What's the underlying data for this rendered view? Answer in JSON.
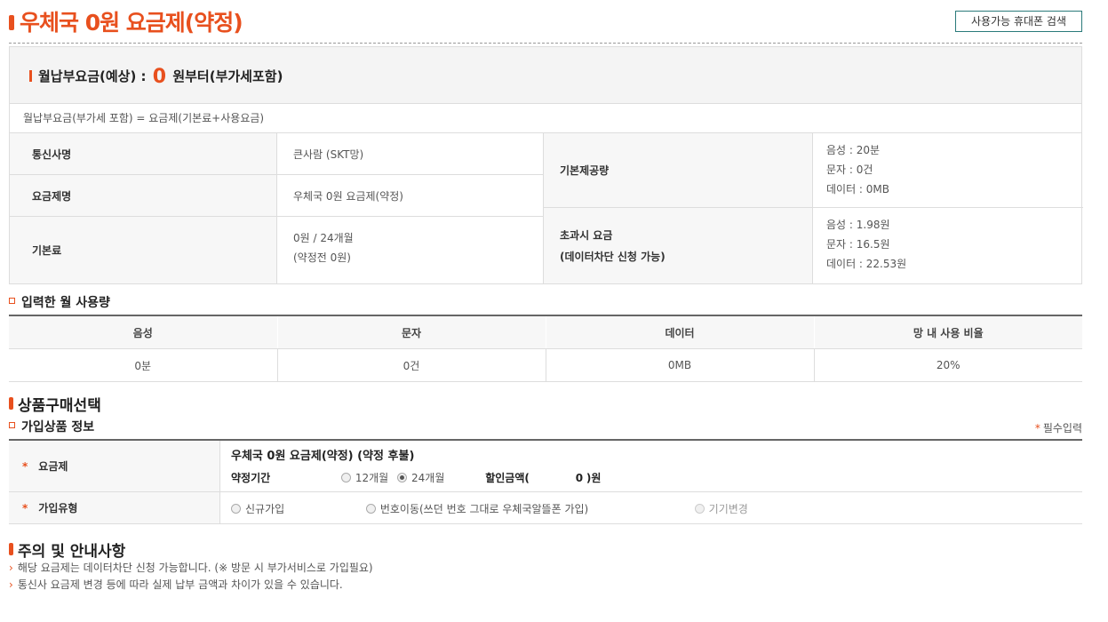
{
  "header": {
    "title": "우체국 0원 요금제(약정)",
    "search_button": "사용가능 휴대폰 검색"
  },
  "summary": {
    "monthly_label": "월납부요금(예상) :",
    "monthly_value": "0",
    "monthly_suffix": "원부터(부가세포함)",
    "formula": "월납부요금(부가세 포함) = 요금제(기본료+사용요금)",
    "carrier_label": "통신사명",
    "carrier_value": "큰사람 (SKT망)",
    "plan_label": "요금제명",
    "plan_value": "우체국 0원 요금제(약정)",
    "base_label": "기본료",
    "base_value_1": "0원 / 24개월",
    "base_value_2": "(약정전 0원)",
    "provided_label": "기본제공량",
    "provided_voice": "음성 : 20분",
    "provided_sms": "문자 : 0건",
    "provided_data": "데이터 : 0MB",
    "overage_label_1": "초과시 요금",
    "overage_label_2": "(데이터차단 신청 가능)",
    "overage_voice": "음성 : 1.98원",
    "overage_sms": "문자 : 16.5원",
    "overage_data": "데이터 : 22.53원"
  },
  "usage": {
    "heading": "입력한 월 사용량",
    "headers": [
      "음성",
      "문자",
      "데이터",
      "망 내 사용 비율"
    ],
    "values": [
      "0분",
      "0건",
      "0MB",
      "20%"
    ]
  },
  "purchase": {
    "heading": "상품구매선택",
    "sub_heading": "가입상품 정보",
    "required_note": "필수입력",
    "required_star": "*",
    "plan_label": "요금제",
    "plan_name": "우체국 0원 요금제(약정) (약정 후불)",
    "term_label": "약정기간",
    "term_options": [
      "12개월",
      "24개월"
    ],
    "term_selected": "24개월",
    "discount_label": "할인금액(",
    "discount_value": "0",
    "discount_suffix": ")원",
    "type_label": "가입유형",
    "type_options": [
      "신규가입",
      "번호이동(쓰던 번호 그대로 우체국알뜰폰 가입)",
      "기기변경"
    ]
  },
  "notes": {
    "heading": "주의 및 안내사항",
    "items": [
      "해당 요금제는 데이터차단 신청 가능합니다. (※ 방문 시 부가서비스로 가입필요)",
      "통신사 요금제 변경 등에 따라 실제 납부 금액과 차이가 있을 수 있습니다."
    ]
  },
  "colors": {
    "accent": "#e8501e",
    "border": "#dddddd",
    "label_bg": "#f7f7f7"
  }
}
